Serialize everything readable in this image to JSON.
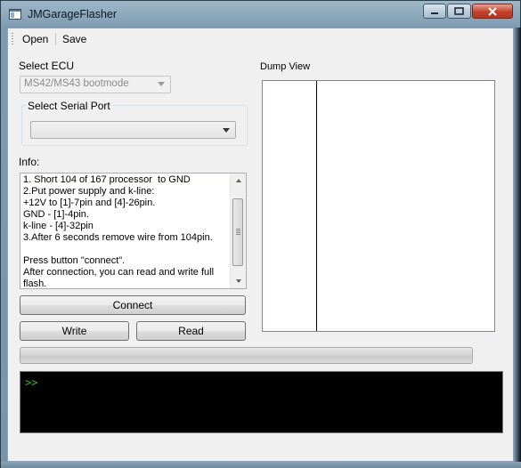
{
  "window": {
    "title": "JMGarageFlasher",
    "icons": {
      "app": "app-icon",
      "minimize": "minimize-icon",
      "maximize": "maximize-icon",
      "close": "close-icon"
    }
  },
  "menu": {
    "open": "Open",
    "save": "Save"
  },
  "ecu": {
    "label": "Select ECU",
    "selected": "MS42/MS43 bootmode"
  },
  "serial": {
    "label": "Select Serial Port",
    "selected": ""
  },
  "info": {
    "label": "Info:",
    "text": "1. Short 104 of 167 processor  to GND\n2.Put power supply and k-line:\n+12V to [1]-7pin and [4]-26pin.\nGND - [1]-4pin.\nk-line - [4]-32pin\n3.After 6 seconds remove wire from 104pin.\n\nPress button \"connect\".\nAfter connection, you can read and write full\nflash."
  },
  "buttons": {
    "connect": "Connect",
    "write": "Write",
    "read": "Read"
  },
  "dump": {
    "label": "Dump View"
  },
  "progress": {
    "value": 0
  },
  "console": {
    "prompt": ">>",
    "prompt_color": "#22c322"
  }
}
